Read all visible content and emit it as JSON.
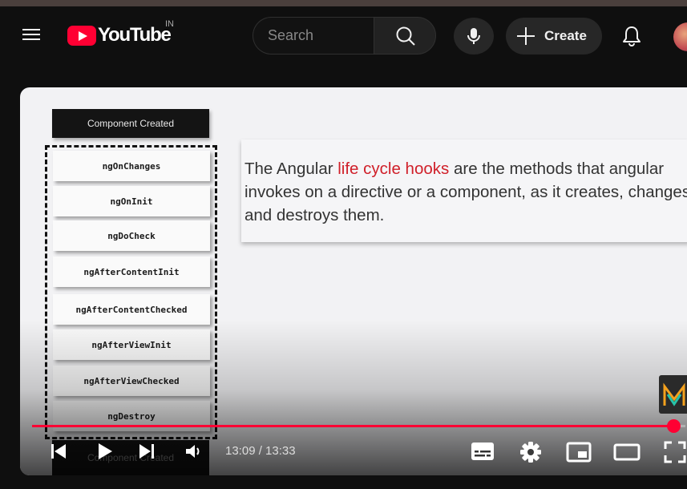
{
  "masthead": {
    "logo_text": "YouTube",
    "country_code": "IN",
    "search": {
      "placeholder": "Search",
      "value": ""
    },
    "create_label": "Create",
    "icons": [
      "menu-icon",
      "search-icon",
      "microphone-icon",
      "plus-icon",
      "bell-icon",
      "avatar"
    ]
  },
  "slide": {
    "header_label": "Component Created",
    "hooks": [
      "ngOnChanges",
      "ngOnInit",
      "ngDoCheck",
      "ngAfterContentInit",
      "ngAfterContentChecked",
      "ngAfterViewInit",
      "ngAfterViewChecked",
      "ngDestroy"
    ],
    "footer_label": "Component Created",
    "description_before": "The Angular ",
    "description_highlight": "life cycle hooks",
    "description_after": " are the methods that angular invokes on a directive or a component, as it creates, changes and destroys them.",
    "highlight_color": "#d0202a"
  },
  "player": {
    "current_time": "13:09",
    "duration": "13:33",
    "time_display": "13:09 / 13:33",
    "progress_fraction": 0.982,
    "accent_color": "#ff0033",
    "controls": [
      "previous-icon",
      "play-icon",
      "next-icon",
      "volume-icon",
      "subtitles-icon",
      "settings-gear-icon",
      "miniplayer-icon",
      "theater-mode-icon",
      "fullscreen-icon"
    ]
  }
}
